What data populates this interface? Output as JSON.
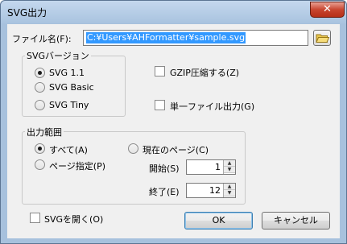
{
  "window": {
    "title": "SVG出力",
    "close_glyph": "✕"
  },
  "file": {
    "label": "ファイル名(F):",
    "value": "C:¥Users¥AHFormatter¥sample.svg",
    "browse_icon": "folder-icon"
  },
  "version_group": {
    "legend": "SVGバージョン",
    "options": [
      "SVG 1.1",
      "SVG Basic",
      "SVG Tiny"
    ],
    "selected": "SVG 1.1"
  },
  "gzip_label": "GZIP圧縮する(Z)",
  "single_file_label": "単一ファイル出力(G)",
  "range_group": {
    "legend": "出力範囲",
    "all_label": "すべて(A)",
    "current_label": "現在のページ(C)",
    "specified_label": "ページ指定(P)",
    "start_label": "開始(S)",
    "start_value": "1",
    "end_label": "終了(E)",
    "end_value": "12",
    "selected": "すべて(A)"
  },
  "open_svg_label": "SVGを開く(O)",
  "buttons": {
    "ok": "OK",
    "cancel": "キャンセル"
  }
}
